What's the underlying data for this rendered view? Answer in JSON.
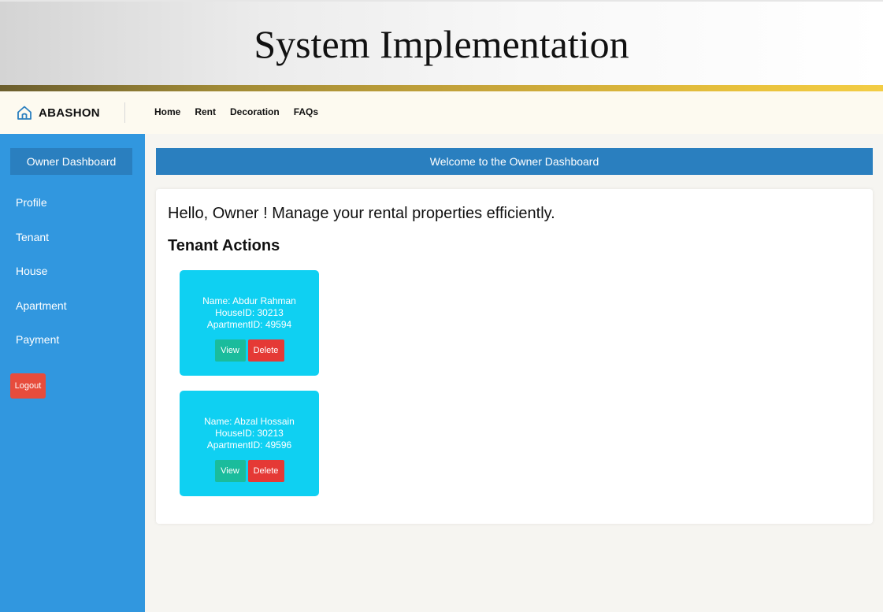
{
  "slide": {
    "title": "System Implementation"
  },
  "navbar": {
    "brand": "ABASHON",
    "brand_icon": "house-icon",
    "links": [
      "Home",
      "Rent",
      "Decoration",
      "FAQs"
    ]
  },
  "sidebar": {
    "title": "Owner Dashboard",
    "items": [
      "Profile",
      "Tenant",
      "House",
      "Apartment",
      "Payment"
    ],
    "logout_label": "Logout"
  },
  "main": {
    "welcome": "Welcome to the Owner Dashboard",
    "greeting": "Hello, Owner ! Manage your rental properties efficiently.",
    "section_heading": "Tenant Actions",
    "tenants": [
      {
        "name": "Name: Abdur Rahman",
        "house": "HouseID: 30213",
        "apartment": "ApartmentID: 49594",
        "view_label": "View",
        "delete_label": "Delete"
      },
      {
        "name": "Name: Abzal Hossain",
        "house": "HouseID: 30213",
        "apartment": "ApartmentID: 49596",
        "view_label": "View",
        "delete_label": "Delete"
      }
    ]
  },
  "colors": {
    "sidebar": "#3197df",
    "header_bar": "#2a7fbf",
    "tenant_card": "#0fd0f2",
    "view_button": "#1abc9c",
    "delete_button": "#e53935",
    "logout_button": "#e74c3c"
  }
}
